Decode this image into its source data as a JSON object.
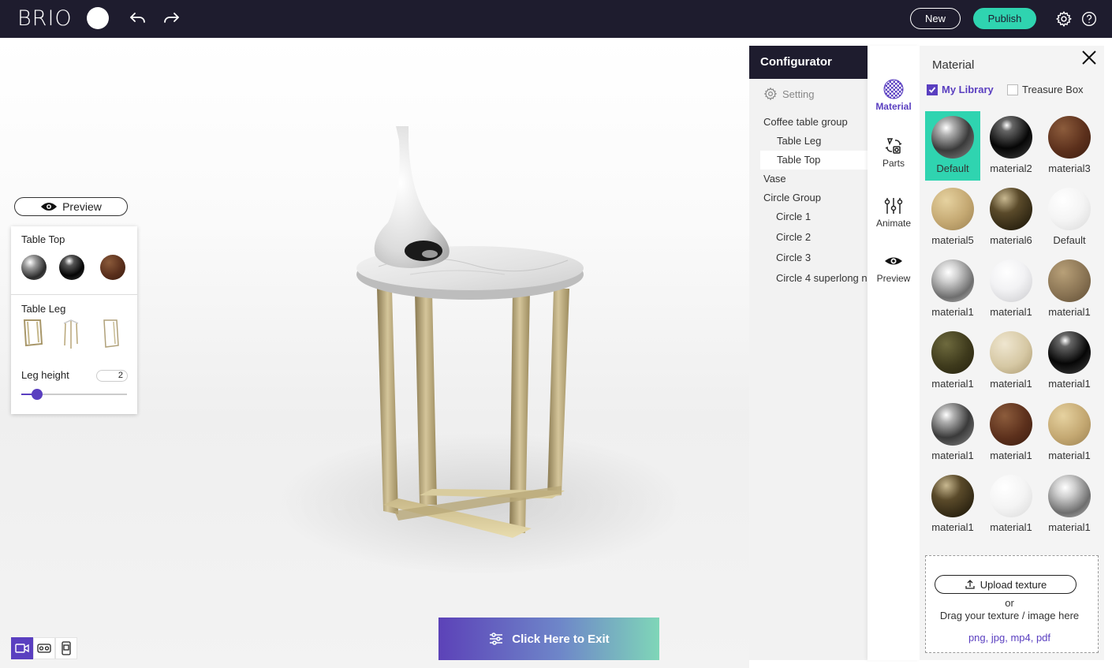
{
  "app": {
    "logo": "BRIO",
    "new_label": "New",
    "publish_label": "Publish",
    "accent": "#5a3fc0",
    "teal": "#2fd4b0",
    "topbar_color": "#1e1c2e"
  },
  "viewport": {
    "preview_label": "Preview",
    "exit_label": "Click Here to Exit",
    "options": {
      "table_top_label": "Table Top",
      "table_leg_label": "Table Leg",
      "leg_height_label": "Leg height",
      "leg_height_value": "2",
      "leg_height_fraction": 0.15
    }
  },
  "configurator": {
    "title": "Configurator",
    "setting_label": "Setting",
    "tree": [
      {
        "label": "Coffee table group",
        "level": 0
      },
      {
        "label": "Table Leg",
        "level": 1
      },
      {
        "label": "Table Top",
        "level": 1,
        "selected": true
      },
      {
        "label": "Vase",
        "level": 0
      },
      {
        "label": "Circle Group",
        "level": 0
      },
      {
        "label": "Circle 1",
        "level": 1
      },
      {
        "label": "Circle 2",
        "level": 1
      },
      {
        "label": "Circle 3",
        "level": 1
      },
      {
        "label": "Circle 4 superlong n",
        "level": 1
      }
    ]
  },
  "tabs": [
    {
      "label": "Material",
      "icon": "material-icon",
      "active": true
    },
    {
      "label": "Parts",
      "icon": "parts-icon"
    },
    {
      "label": "Animate",
      "icon": "animate-icon"
    },
    {
      "label": "Preview",
      "icon": "eye-icon"
    }
  ],
  "material_panel": {
    "title": "Material",
    "my_library_label": "My Library",
    "treasure_box_label": "Treasure Box",
    "materials": [
      {
        "name": "Default",
        "kind": "chrome",
        "selected": true
      },
      {
        "name": "material2",
        "kind": "black-gloss"
      },
      {
        "name": "material3",
        "kind": "rust"
      },
      {
        "name": "material5",
        "kind": "sand"
      },
      {
        "name": "material6",
        "kind": "bronze"
      },
      {
        "name": "Default",
        "kind": "white"
      },
      {
        "name": "material1",
        "kind": "silver"
      },
      {
        "name": "material1",
        "kind": "pearl"
      },
      {
        "name": "material1",
        "kind": "stone"
      },
      {
        "name": "material1",
        "kind": "olive"
      },
      {
        "name": "material1",
        "kind": "speckle"
      },
      {
        "name": "material1",
        "kind": "black-gloss"
      },
      {
        "name": "material1",
        "kind": "chrome"
      },
      {
        "name": "material1",
        "kind": "rust"
      },
      {
        "name": "material1",
        "kind": "sand"
      },
      {
        "name": "material1",
        "kind": "bronze"
      },
      {
        "name": "material1",
        "kind": "white"
      },
      {
        "name": "material1",
        "kind": "silver"
      }
    ],
    "upload_label": "Upload texture",
    "or_label": "or",
    "drag_label": "Drag your texture / image here",
    "types_label": "png, jpg, mp4, pdf"
  }
}
